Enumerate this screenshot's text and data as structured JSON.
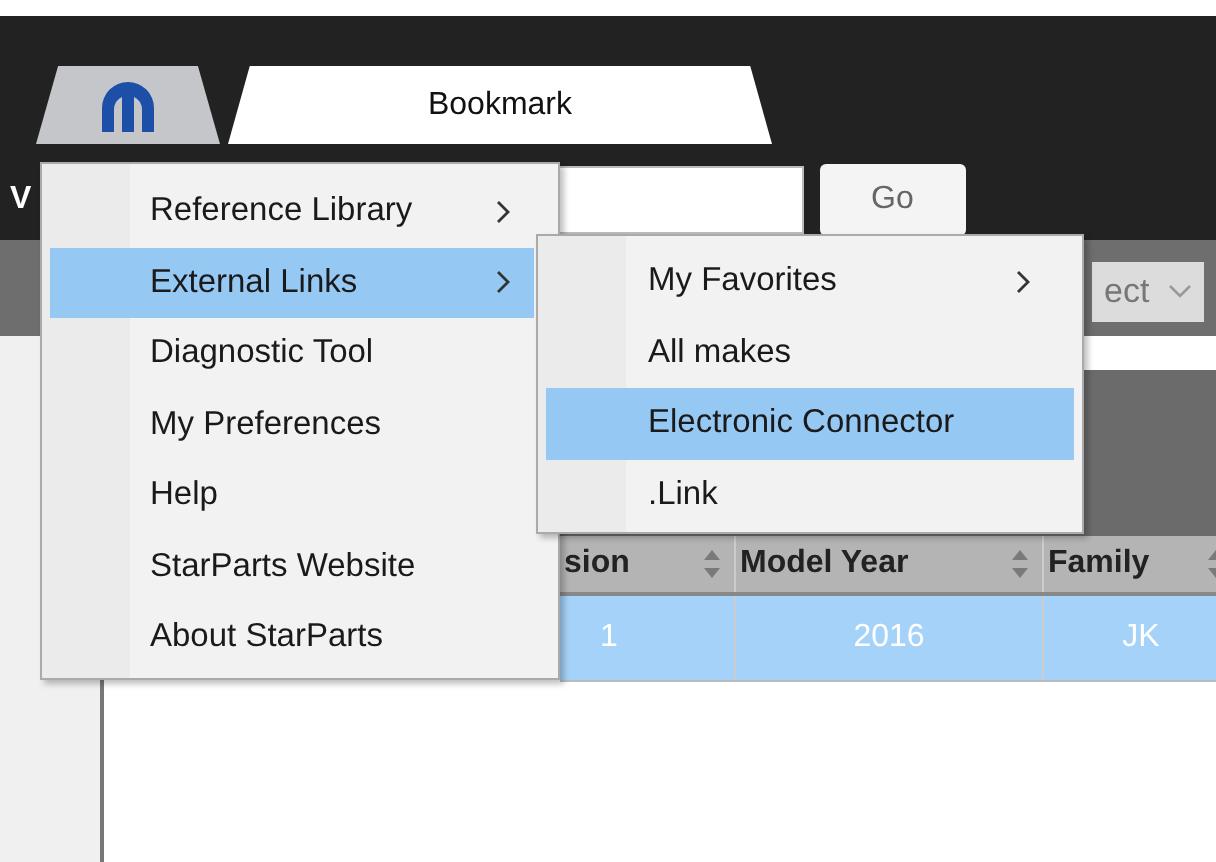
{
  "tabs": [
    {
      "kind": "logo",
      "selected": false
    },
    {
      "kind": "text",
      "label": "Bookmark",
      "selected": true
    }
  ],
  "search": {
    "label": "V",
    "button": "Go"
  },
  "toolbar": {
    "select_value": "ect"
  },
  "table": {
    "columns": [
      "sion",
      "Model Year",
      "Family"
    ],
    "rows": [
      {
        "cells": [
          "1",
          "2016",
          "JK"
        ],
        "selected": true
      }
    ]
  },
  "menu": {
    "items": [
      {
        "label": "Reference Library",
        "submenu": true,
        "selected": false
      },
      {
        "label": "External Links",
        "submenu": true,
        "selected": true
      },
      {
        "label": "Diagnostic Tool",
        "submenu": false,
        "selected": false
      },
      {
        "label": "My Preferences",
        "submenu": false,
        "selected": false
      },
      {
        "label": "Help",
        "submenu": false,
        "selected": false
      },
      {
        "label": "StarParts Website",
        "submenu": false,
        "selected": false
      },
      {
        "label": "About StarParts",
        "submenu": false,
        "selected": false
      }
    ]
  },
  "submenu": {
    "items": [
      {
        "label": "My Favorites",
        "submenu": true,
        "selected": false
      },
      {
        "label": "All makes",
        "submenu": false,
        "selected": false
      },
      {
        "label": "Electronic Connector",
        "submenu": false,
        "selected": true
      },
      {
        "label": ".Link",
        "submenu": false,
        "selected": false
      }
    ]
  }
}
